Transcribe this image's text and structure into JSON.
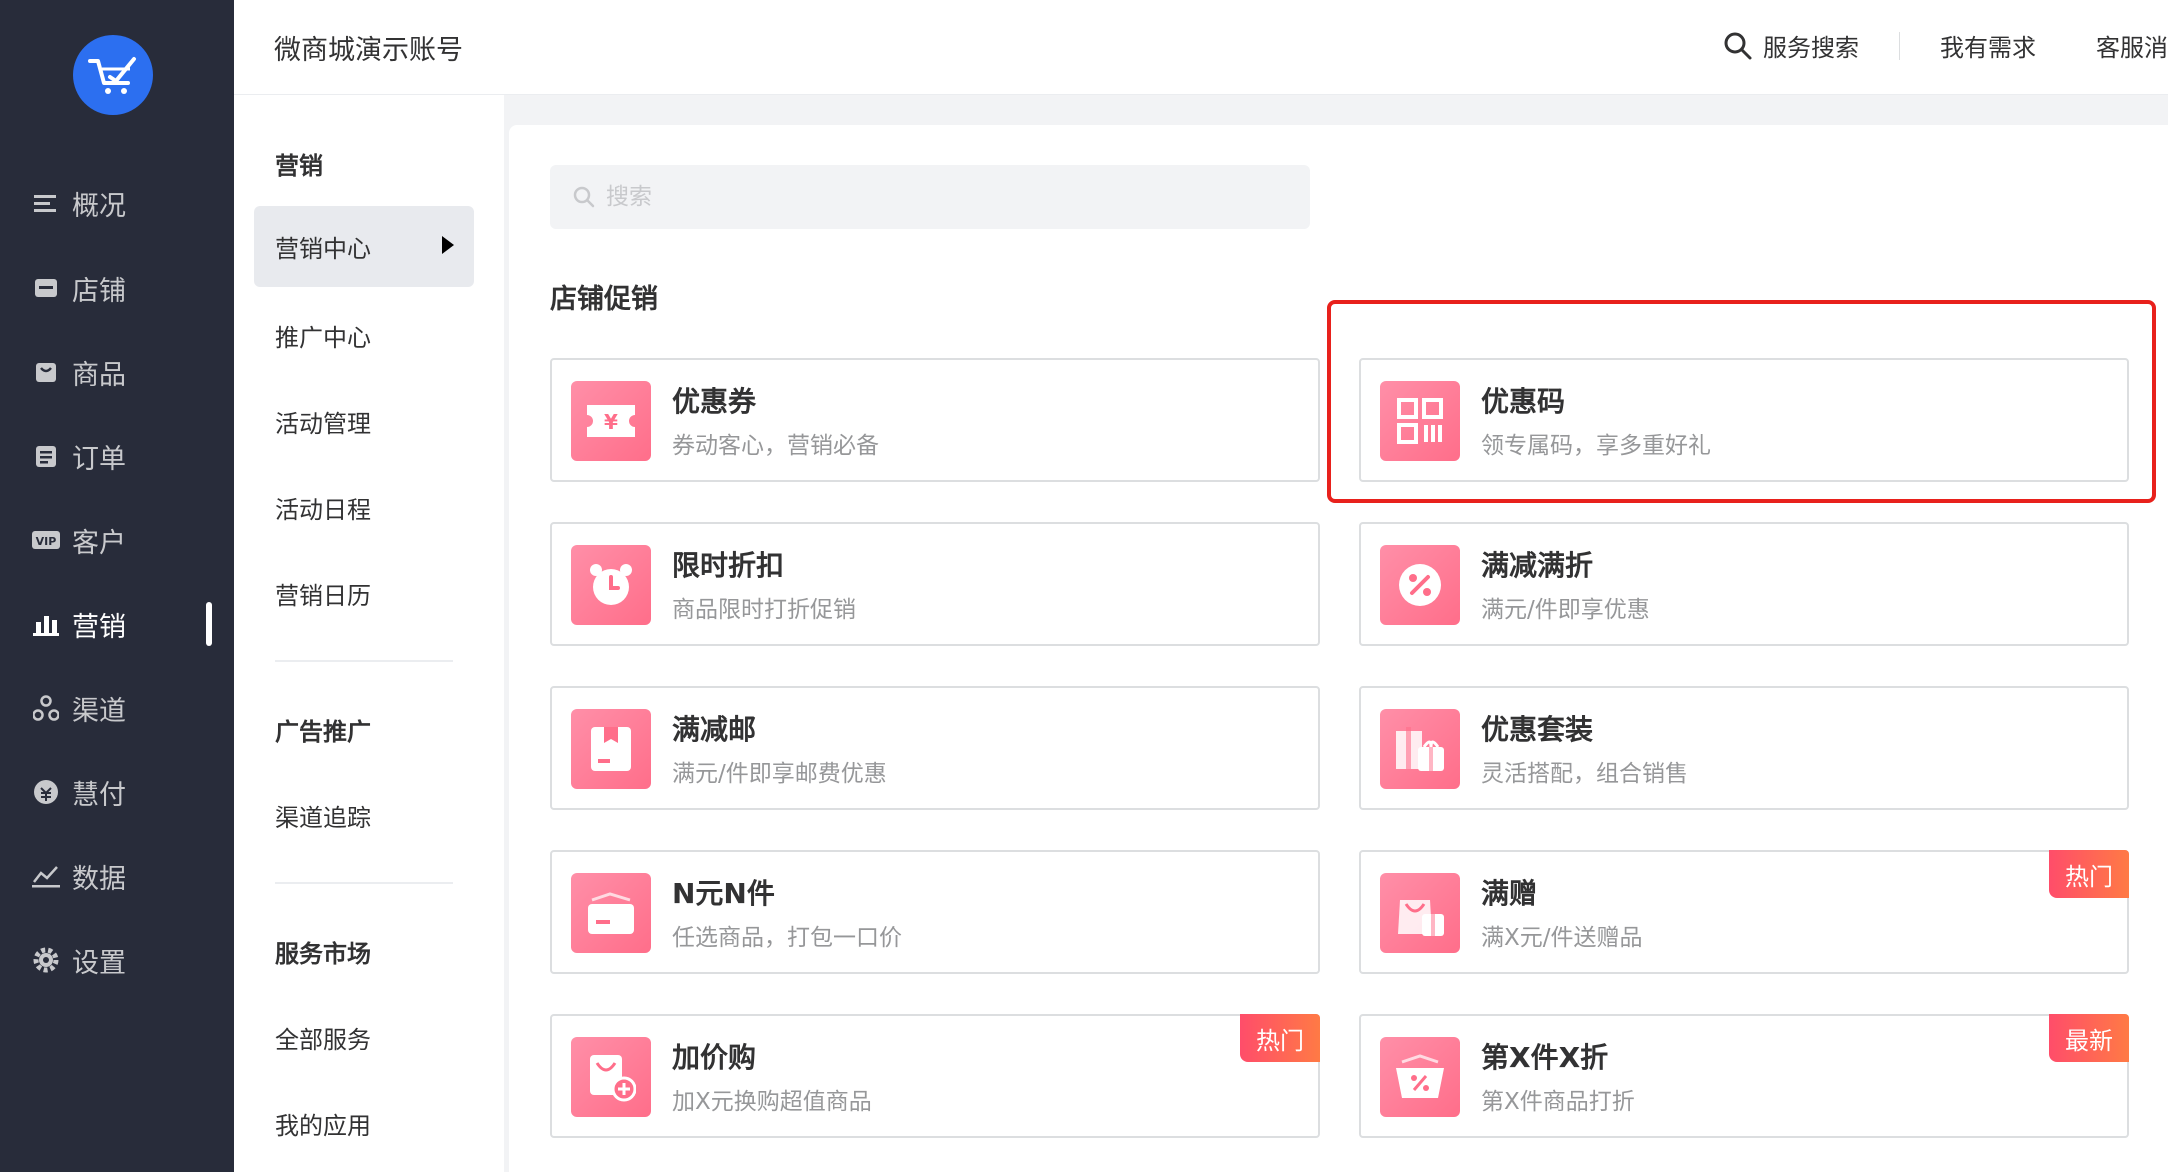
{
  "colors": {
    "nav_bg": "#282c3a",
    "brand": "#2c6ff0",
    "card_icon": "#ff7a94",
    "badge": "#ff5a5f",
    "highlight": "#e8211c"
  },
  "nav": {
    "logo_icon": "cart-check-logo-icon",
    "items": [
      {
        "label": "概况",
        "icon": "menu-icon"
      },
      {
        "label": "店铺",
        "icon": "store-icon"
      },
      {
        "label": "商品",
        "icon": "bag-icon"
      },
      {
        "label": "订单",
        "icon": "order-icon"
      },
      {
        "label": "客户",
        "icon": "vip-icon"
      },
      {
        "label": "营销",
        "icon": "bar-chart-icon"
      },
      {
        "label": "渠道",
        "icon": "channel-icon"
      },
      {
        "label": "慧付",
        "icon": "pay-icon"
      },
      {
        "label": "数据",
        "icon": "line-chart-icon"
      },
      {
        "label": "设置",
        "icon": "gear-icon"
      }
    ],
    "active": "营销"
  },
  "header": {
    "title": "微商城演示账号",
    "search_label": "服务搜索",
    "needs_label": "我有需求",
    "service_label": "客服消"
  },
  "subnav": {
    "heading_marketing": "营销",
    "marketing_center": "营销中心",
    "promotion_center": "推广中心",
    "activity_mgmt": "活动管理",
    "activity_schedule": "活动日程",
    "marketing_calendar": "营销日历",
    "heading_ads": "广告推广",
    "channel_tracking": "渠道追踪",
    "heading_service": "服务市场",
    "all_services": "全部服务",
    "my_apps": "我的应用"
  },
  "main": {
    "search_placeholder": "搜索",
    "section_title": "店铺促销",
    "cards": [
      {
        "title": "优惠券",
        "desc": "券动客心，营销必备",
        "icon": "coupon-icon",
        "badge": ""
      },
      {
        "title": "优惠码",
        "desc": "领专属码，享多重好礼",
        "icon": "qr-code-icon",
        "badge": ""
      },
      {
        "title": "限时折扣",
        "desc": "商品限时打折促销",
        "icon": "alarm-clock-icon",
        "badge": ""
      },
      {
        "title": "满减满折",
        "desc": "满元/件即享优惠",
        "icon": "percent-icon",
        "badge": ""
      },
      {
        "title": "满减邮",
        "desc": "满元/件即享邮费优惠",
        "icon": "parcel-icon",
        "badge": ""
      },
      {
        "title": "优惠套装",
        "desc": "灵活搭配，组合销售",
        "icon": "gift-bundle-icon",
        "badge": ""
      },
      {
        "title": "N元N件",
        "desc": "任选商品，打包一口价",
        "icon": "basket-icon",
        "badge": ""
      },
      {
        "title": "满赠",
        "desc": "满X元/件送赠品",
        "icon": "gift-bag-icon",
        "badge": "热门"
      },
      {
        "title": "加价购",
        "desc": "加X元换购超值商品",
        "icon": "bag-plus-icon",
        "badge": "热门"
      },
      {
        "title": "第X件X折",
        "desc": "第X件商品打折",
        "icon": "discount-basket-icon",
        "badge": "最新"
      }
    ]
  }
}
